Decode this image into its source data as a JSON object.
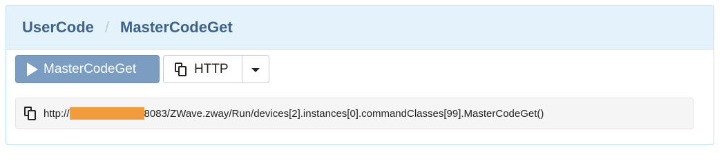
{
  "breadcrumb": {
    "items": [
      "UserCode",
      "MasterCodeGet"
    ],
    "separator": "/"
  },
  "toolbar": {
    "run_button_label": "MasterCodeGet",
    "run_button_icon": "play-icon",
    "http_button_label": "HTTP",
    "http_button_icon": "copy-icon",
    "dropdown_icon": "caret-down-icon"
  },
  "url": {
    "prefix": "http://",
    "redaction_color": "#f29b3b",
    "suffix": "8083/ZWave.zway/Run/devices[2].instances[0].commandClasses[99].MasterCodeGet()",
    "copy_icon": "copy-icon"
  },
  "colors": {
    "heading_bg": "#e3f2fb",
    "heading_text": "#3d6389",
    "run_button_bg": "#7a9dc1",
    "panel_border": "#bce1ee"
  }
}
